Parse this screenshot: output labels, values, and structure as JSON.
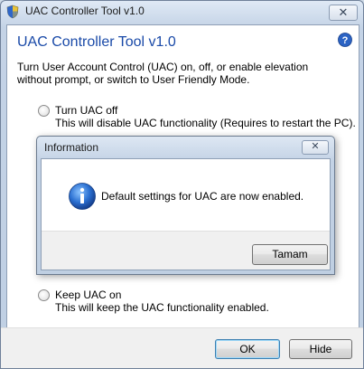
{
  "window": {
    "title": "UAC Controller Tool v1.0",
    "close_glyph": "✕"
  },
  "header": {
    "title": "UAC Controller Tool v1.0",
    "description": "Turn User Account Control (UAC) on, off, or enable elevation without prompt, or switch to User Friendly Mode."
  },
  "options": [
    {
      "label": "Turn UAC off",
      "description": "This will disable UAC functionality (Requires to restart the PC)."
    },
    {
      "label": "Keep UAC on",
      "description": "This will keep the UAC functionality enabled."
    }
  ],
  "footer": {
    "ok_label": "OK",
    "hide_label": "Hide"
  },
  "dialog": {
    "title": "Information",
    "close_glyph": "✕",
    "message": "Default settings for UAC are now enabled.",
    "button_label": "Tamam"
  },
  "colors": {
    "accent_title": "#1a4aa8",
    "info_icon": "#1f64c8"
  },
  "icons": [
    "shield-icon",
    "close-icon",
    "help-icon",
    "info-icon"
  ]
}
